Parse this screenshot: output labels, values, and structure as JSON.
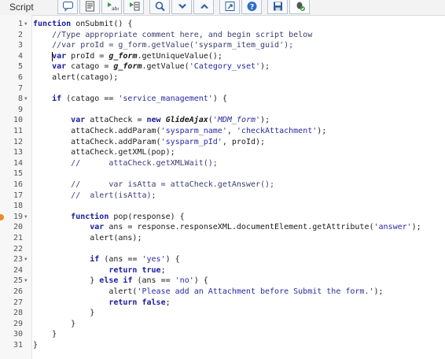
{
  "panel": {
    "title": "Script"
  },
  "toolbar": {
    "buttons": [
      {
        "name": "toggle-comment-button",
        "icon": "speech-bubble-icon"
      },
      {
        "name": "format-code-button",
        "icon": "document-lines-icon"
      },
      {
        "name": "replace-button",
        "icon": "find-replace-icon"
      },
      {
        "name": "replace-all-button",
        "icon": "replace-all-icon"
      },
      {
        "name": "search-button",
        "icon": "magnifier-icon"
      },
      {
        "name": "next-button",
        "icon": "chevron-down-icon"
      },
      {
        "name": "previous-button",
        "icon": "chevron-up-icon"
      },
      {
        "name": "fullscreen-button",
        "icon": "expand-icon"
      },
      {
        "name": "help-button",
        "icon": "help-icon"
      },
      {
        "name": "save-button",
        "icon": "floppy-disk-icon"
      },
      {
        "name": "script-debugger-button",
        "icon": "bug-check-icon"
      }
    ]
  },
  "editor": {
    "lines": [
      {
        "n": "1",
        "fold": true,
        "html": "<span class=\"kw\">function</span> onSubmit() {"
      },
      {
        "n": "2",
        "fold": false,
        "html": "    <span class=\"cm\">//Type appropriate comment here, and begin script below</span>"
      },
      {
        "n": "3",
        "fold": false,
        "html": "    <span class=\"cm\">//var proId = g_form.getValue('sysparm_item_guid');</span>"
      },
      {
        "n": "4",
        "fold": false,
        "html": "    <span class=\"kw\">var</span> proId = <span class=\"ital\">g_form</span>.getUniqueValue();"
      },
      {
        "n": "5",
        "fold": false,
        "html": "    <span class=\"kw\">var</span> catago = <span class=\"ital\">g_form</span>.getValue(<span class=\"str\">'Category_vset'</span>);"
      },
      {
        "n": "6",
        "fold": false,
        "html": "    alert(catago);"
      },
      {
        "n": "7",
        "fold": false,
        "html": ""
      },
      {
        "n": "8",
        "fold": true,
        "html": "    <span class=\"kw\">if</span> (catago == <span class=\"str\">'service_management'</span>) {"
      },
      {
        "n": "9",
        "fold": false,
        "html": ""
      },
      {
        "n": "10",
        "fold": false,
        "html": "        <span class=\"kw\">var</span> attaCheck = <span class=\"kw\">new</span> <span class=\"ital\">GlideAjax</span>(<span class=\"str\" style=\"font-style:italic\">'MDM_form'</span>);"
      },
      {
        "n": "11",
        "fold": false,
        "html": "        attaCheck.addParam(<span class=\"str\">'sysparm_name'</span>, <span class=\"str\">'checkAttachment'</span>);"
      },
      {
        "n": "12",
        "fold": false,
        "html": "        attaCheck.addParam(<span class=\"str\">'sysparm_pId'</span>, proId);"
      },
      {
        "n": "13",
        "fold": false,
        "html": "        attaCheck.getXML(pop);"
      },
      {
        "n": "14",
        "fold": false,
        "html": "        <span class=\"cm\">//      attaCheck.getXMLWait();</span>"
      },
      {
        "n": "15",
        "fold": false,
        "html": ""
      },
      {
        "n": "16",
        "fold": false,
        "html": "        <span class=\"cm\">//      var isAtta = attaCheck.getAnswer();</span>"
      },
      {
        "n": "17",
        "fold": false,
        "html": "        <span class=\"cm\">//  alert(isAtta);</span>"
      },
      {
        "n": "18",
        "fold": false,
        "html": ""
      },
      {
        "n": "19",
        "fold": true,
        "marker": true,
        "html": "        <span class=\"kw\">function</span> pop(response) {"
      },
      {
        "n": "20",
        "fold": false,
        "html": "            <span class=\"kw\">var</span> ans = response.responseXML.documentElement.getAttribute(<span class=\"str\">'answer'</span>);"
      },
      {
        "n": "21",
        "fold": false,
        "html": "            alert(ans);"
      },
      {
        "n": "22",
        "fold": false,
        "html": ""
      },
      {
        "n": "23",
        "fold": true,
        "html": "            <span class=\"kw\">if</span> (ans == <span class=\"str\">'yes'</span>) {"
      },
      {
        "n": "24",
        "fold": false,
        "html": "                <span class=\"kw\">return</span> <span class=\"kw\">true</span>;"
      },
      {
        "n": "25",
        "fold": true,
        "html": "            } <span class=\"kw\">else</span> <span class=\"kw\">if</span> (ans == <span class=\"str\">'no'</span>) {"
      },
      {
        "n": "26",
        "fold": false,
        "html": "                alert(<span class=\"str\">'Please add an Attachment before Submit the form.'</span>);"
      },
      {
        "n": "27",
        "fold": false,
        "html": "                <span class=\"kw\">return</span> <span class=\"kw\">false</span>;"
      },
      {
        "n": "28",
        "fold": false,
        "html": "            }"
      },
      {
        "n": "29",
        "fold": false,
        "html": "        }"
      },
      {
        "n": "30",
        "fold": false,
        "html": "    }"
      },
      {
        "n": "31",
        "fold": false,
        "html": "}"
      }
    ]
  }
}
